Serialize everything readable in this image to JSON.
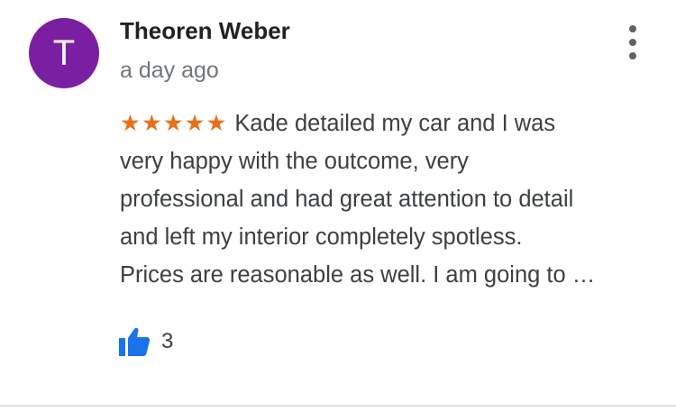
{
  "review": {
    "author": {
      "name": "Theoren Weber",
      "initial": "T",
      "avatar_color": "#7b1fa2"
    },
    "timestamp": "a day ago",
    "rating": 5,
    "stars": "★★★★★",
    "star_color": "#e7711b",
    "text_lines": [
      "Kade detailed my car and I was",
      "very happy with the outcome, very",
      "professional and had great attention to detail",
      "and left my interior completely spotless.",
      "Prices are reasonable as well. I am going to …"
    ],
    "likes": "3",
    "like_icon": "thumbs-up-icon",
    "like_icon_color": "#1a73e8",
    "menu_icon": "more-vert-icon"
  }
}
